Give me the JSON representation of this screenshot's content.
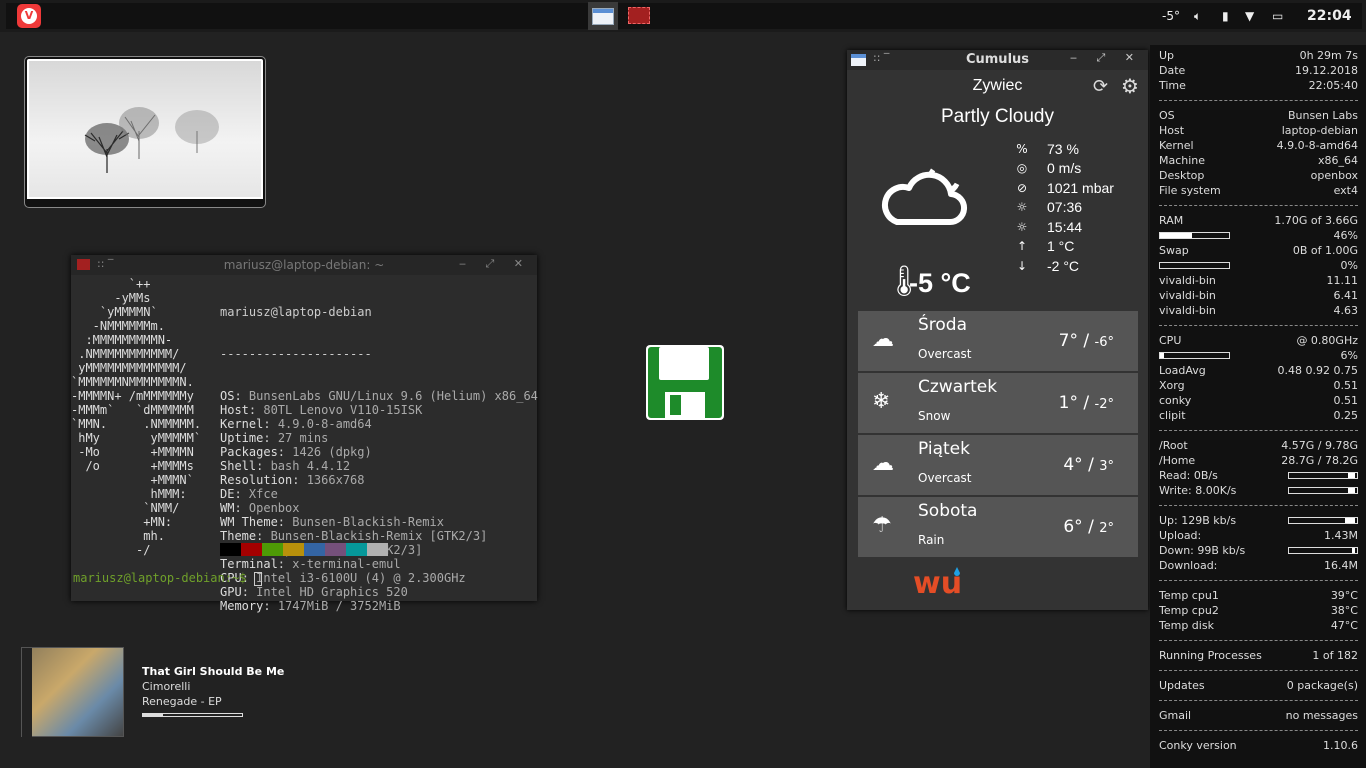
{
  "panel": {
    "temp": "-5°",
    "clock": "22:04"
  },
  "terminal": {
    "title": "mariusz@laptop-debian: ~",
    "logo": "        `++\n      -yMMs\n    `yMMMMN`\n   -NMMMMMMm.\n  :MMMMMMMMMN-\n .NMMMMMMMMMMM/\n yMMMMMMMMMMMMM/\n`MMMMMMNMMMMMMMN.\n-MMMMN+ /mMMMMMMy\n-MMMm`   `dMMMMMM\n`MMN.     .NMMMMM.\n hMy       yMMMMM`\n -Mo       +MMMMN\n  /o       +MMMMs\n           +MMMN`\n           hMMM:\n          `NMM/\n          +MN:\n          mh.\n         -/",
    "user_host": "mariusz@laptop-debian",
    "dashes": "---------------------",
    "info": [
      {
        "k": "OS",
        "v": "BunsenLabs GNU/Linux 9.6 (Helium) x86_64"
      },
      {
        "k": "Host",
        "v": "80TL Lenovo V110-15ISK"
      },
      {
        "k": "Kernel",
        "v": "4.9.0-8-amd64"
      },
      {
        "k": "Uptime",
        "v": "27 mins"
      },
      {
        "k": "Packages",
        "v": "1426 (dpkg)"
      },
      {
        "k": "Shell",
        "v": "bash 4.4.12"
      },
      {
        "k": "Resolution",
        "v": "1366x768"
      },
      {
        "k": "DE",
        "v": "Xfce"
      },
      {
        "k": "WM",
        "v": "Openbox"
      },
      {
        "k": "WM Theme",
        "v": "Bunsen-Blackish-Remix"
      },
      {
        "k": "Theme",
        "v": "Bunsen-Blackish-Remix [GTK2/3]"
      },
      {
        "k": "Icons",
        "v": "Paper-Bunsen [GTK2/3]"
      },
      {
        "k": "Terminal",
        "v": "x-terminal-emul"
      },
      {
        "k": "CPU",
        "v": "Intel i3-6100U (4) @ 2.300GHz"
      },
      {
        "k": "GPU",
        "v": "Intel HD Graphics 520"
      },
      {
        "k": "Memory",
        "v": "1747MiB / 3752MiB"
      }
    ],
    "swatch_colors": [
      "#000000",
      "#a40000",
      "#4e9a06",
      "#b8900b",
      "#3465a4",
      "#75507b",
      "#06989a",
      "#b0b0b0"
    ],
    "prompt": "mariusz@laptop-debian:~$ "
  },
  "weather": {
    "title": "Cumulus",
    "city": "Zywiec",
    "condition": "Partly Cloudy",
    "temperature": "-5 °C",
    "details": [
      {
        "icon": "humidity-icon",
        "glyph": "%",
        "value": "73 %"
      },
      {
        "icon": "wind-icon",
        "glyph": "◎",
        "value": "0 m/s"
      },
      {
        "icon": "pressure-icon",
        "glyph": "⊘",
        "value": "1021 mbar"
      },
      {
        "icon": "sunrise-icon",
        "glyph": "☼",
        "value": "07:36"
      },
      {
        "icon": "sunset-icon",
        "glyph": "☼",
        "value": "15:44"
      },
      {
        "icon": "temp-high-icon",
        "glyph": "↑",
        "value": "1 °C"
      },
      {
        "icon": "temp-low-icon",
        "glyph": "↓",
        "value": "-2 °C"
      }
    ],
    "forecast": [
      {
        "day": "Środa",
        "cond": "Overcast",
        "high": "7°",
        "low": "-6°",
        "icon": "cloud-icon",
        "glyph": "☁"
      },
      {
        "day": "Czwartek",
        "cond": "Snow",
        "high": "1°",
        "low": "-2°",
        "icon": "snow-cloud-icon",
        "glyph": "❄"
      },
      {
        "day": "Piątek",
        "cond": "Overcast",
        "high": "4°",
        "low": "3°",
        "icon": "cloud-icon",
        "glyph": "☁"
      },
      {
        "day": "Sobota",
        "cond": "Rain",
        "high": "6°",
        "low": "2°",
        "icon": "rain-cloud-icon",
        "glyph": "☂"
      }
    ],
    "wu_logo": "wu"
  },
  "music": {
    "title": "That Girl Should Be Me",
    "artist": "Cimorelli",
    "album": "Renegade - EP",
    "progress": 0.2
  },
  "conky": {
    "rows": [
      {
        "k": "Up",
        "v": "0h 29m 7s"
      },
      {
        "k": "Date",
        "v": "19.12.2018"
      },
      {
        "k": "Time",
        "v": "22:05:40"
      },
      {
        "sep": true
      },
      {
        "k": "OS",
        "v": "Bunsen Labs"
      },
      {
        "k": "Host",
        "v": "laptop-debian"
      },
      {
        "k": "Kernel",
        "v": "4.9.0-8-amd64"
      },
      {
        "k": "Machine",
        "v": "x86_64"
      },
      {
        "k": "Desktop",
        "v": "openbox"
      },
      {
        "k": "File system",
        "v": "ext4"
      },
      {
        "sep": true
      },
      {
        "k": "RAM",
        "v": "1.70G of 3.66G"
      },
      {
        "bar": 0.46,
        "v": "46%"
      },
      {
        "k": "Swap",
        "v": "0B of 1.00G"
      },
      {
        "bar": 0,
        "v": "0%"
      },
      {
        "k": "vivaldi-bin",
        "v": "11.11"
      },
      {
        "k": "vivaldi-bin",
        "v": "6.41"
      },
      {
        "k": "vivaldi-bin",
        "v": "4.63"
      },
      {
        "sep": true
      },
      {
        "k": "CPU",
        "v": "@ 0.80GHz"
      },
      {
        "bar": 0.06,
        "v": "6%"
      },
      {
        "k": "LoadAvg",
        "v": "0.48 0.92 0.75"
      },
      {
        "k": "Xorg",
        "v": "0.51"
      },
      {
        "k": "conky",
        "v": "0.51"
      },
      {
        "k": "clipit",
        "v": "0.25"
      },
      {
        "sep": true
      },
      {
        "k": "/Root",
        "v": "4.57G / 9.78G"
      },
      {
        "k": "/Home",
        "v": "28.7G / 78.2G"
      },
      {
        "k": "Read: 0B/s",
        "rbar": 0.1
      },
      {
        "k": "Write: 8.00K/s",
        "rbar": 0.1
      },
      {
        "sep": true
      },
      {
        "k": "Up: 129B kb/s",
        "rbar": 0.15
      },
      {
        "k": "Upload:",
        "v": "1.43M"
      },
      {
        "k": "Down: 99B kb/s",
        "rbar": 0.05
      },
      {
        "k": "Download:",
        "v": "16.4M"
      },
      {
        "sep": true
      },
      {
        "k": "Temp cpu1",
        "v": "39°C"
      },
      {
        "k": "Temp cpu2",
        "v": "38°C"
      },
      {
        "k": "Temp disk",
        "v": "47°C"
      },
      {
        "sep": true
      },
      {
        "k": "Running Processes",
        "v": "1 of 182"
      },
      {
        "sep": true
      },
      {
        "k": "Updates",
        "v": "0 package(s)"
      },
      {
        "sep": true
      },
      {
        "k": "Gmail",
        "v": "no messages"
      },
      {
        "sep": true
      },
      {
        "k": "Conky version",
        "v": "1.10.6"
      }
    ]
  }
}
